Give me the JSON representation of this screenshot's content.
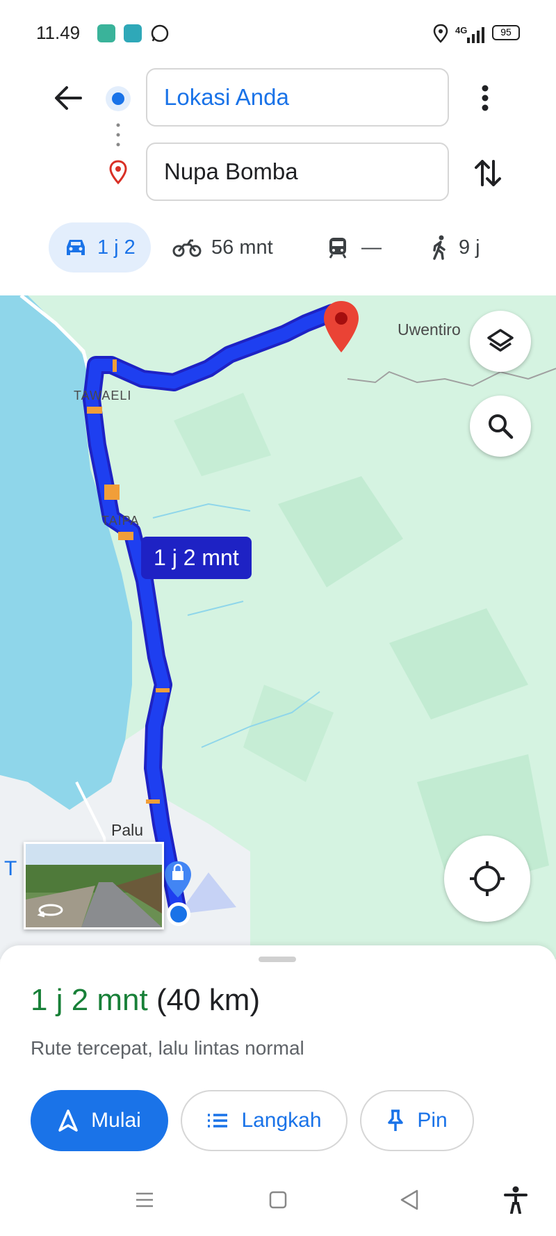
{
  "status_bar": {
    "time": "11.49",
    "network": "4G",
    "battery": "95"
  },
  "directions": {
    "origin": "Lokasi Anda",
    "destination": "Nupa Bomba"
  },
  "modes": [
    {
      "name": "car",
      "label": "1 j 2"
    },
    {
      "name": "motorcycle",
      "label": "56 mnt"
    },
    {
      "name": "transit",
      "label": "—"
    },
    {
      "name": "walk",
      "label": "9 j"
    }
  ],
  "map": {
    "labels": {
      "uwentiro": "Uwentiro",
      "tawaeli": "TAWAELI",
      "taipa": "TAIPA",
      "palu": "Palu",
      "edge": "T"
    },
    "route_eta": "1 j 2 mnt"
  },
  "route_summary": {
    "duration": "1 j 2 mnt",
    "distance": "(40 km)",
    "description": "Rute tercepat, lalu lintas normal"
  },
  "actions": {
    "start": "Mulai",
    "steps": "Langkah",
    "pin": "Pin"
  },
  "colors": {
    "accent": "#1a73e8",
    "route": "#1e3ff0",
    "duration_green": "#188038",
    "pin_red": "#ea4335"
  }
}
